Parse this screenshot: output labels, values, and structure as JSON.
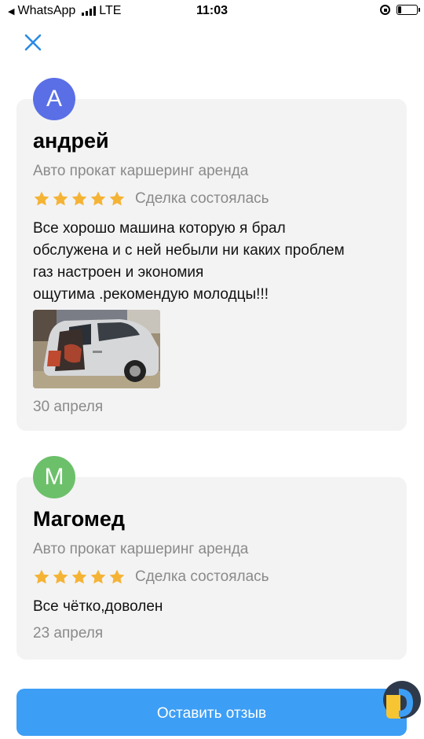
{
  "status_bar": {
    "back_app": "WhatsApp",
    "network": "LTE",
    "time": "11:03"
  },
  "reviews": [
    {
      "avatar_letter": "А",
      "avatar_color": "#5a6fe6",
      "name": "андрей",
      "category": "Авто прокат каршеринг аренда",
      "rating": 5,
      "deal_status": "Сделка состоялась",
      "text": "Все хорошо машина которую я брал\nобслужена и с ней небыли ни каких проблем\nгаз настроен и экономия\nощутима .рекомендую молодцы!!!",
      "has_photo": true,
      "date": "30 апреля"
    },
    {
      "avatar_letter": "М",
      "avatar_color": "#6cc06a",
      "name": "Магомед",
      "category": "Авто прокат каршеринг аренда",
      "rating": 5,
      "deal_status": "Сделка состоялась",
      "text": "Все чётко,доволен",
      "has_photo": false,
      "date": "23 апреля"
    }
  ],
  "actions": {
    "leave_review": "Оставить отзыв"
  },
  "colors": {
    "accent": "#3d9ef5",
    "star": "#f5b335",
    "card_bg": "#f3f3f3",
    "muted_text": "#8a8a8a"
  },
  "icons": [
    "back-arrow-icon",
    "signal-icon",
    "rotation-lock-icon",
    "battery-icon",
    "close-icon",
    "star-icon",
    "app-logo-icon"
  ]
}
